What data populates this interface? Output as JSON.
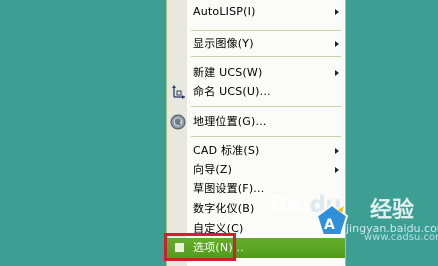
{
  "menu": {
    "items": [
      {
        "label": "AutoLISP(I)",
        "submenu": true
      },
      {
        "label": "显示图像(Y)",
        "submenu": true
      },
      {
        "label": "新建 UCS(W)",
        "submenu": true
      },
      {
        "label": "命名 UCS(U)...",
        "submenu": false,
        "icon": "ucs-axes-icon"
      },
      {
        "label": "地理位置(G)...",
        "submenu": false,
        "icon": "globe-icon"
      },
      {
        "label": "CAD 标准(S)",
        "submenu": true
      },
      {
        "label": "向导(Z)",
        "submenu": true
      },
      {
        "label": "草图设置(F)...",
        "submenu": false
      },
      {
        "label": "数字化仪(B)",
        "submenu": true
      },
      {
        "label": "自定义(C)",
        "submenu": true
      },
      {
        "label": "选项(N)...",
        "submenu": false,
        "highlighted": true,
        "icon": "checkbox-icon"
      }
    ]
  },
  "watermark": {
    "logo_text": "Bai",
    "logo_paw": "du",
    "logo_cn": "经验",
    "url": "jingyan.baidu.com",
    "url2": "www.cadsu.com"
  },
  "colors": {
    "desktop": "#3d9f94",
    "menu_background": "#fbfbf8",
    "highlight": "#5aa523",
    "annotation_frame": "#d0202f"
  }
}
